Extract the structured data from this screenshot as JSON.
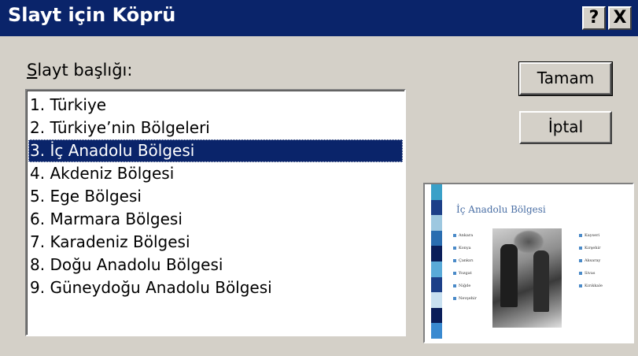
{
  "window": {
    "title": "Slayt için Köprü",
    "help_label": "?",
    "close_label": "X"
  },
  "list": {
    "label_accel": "S",
    "label_rest": "layt başlığı:",
    "selected_index": 2,
    "items": [
      {
        "label": "1. Türkiye"
      },
      {
        "label": "2. Türkiye’nin Bölgeleri"
      },
      {
        "label": "3. İç Anadolu Bölgesi"
      },
      {
        "label": "4. Akdeniz Bölgesi"
      },
      {
        "label": "5. Ege Bölgesi"
      },
      {
        "label": "6. Marmara Bölgesi"
      },
      {
        "label": "7. Karadeniz Bölgesi"
      },
      {
        "label": "8. Doğu Anadolu Bölgesi"
      },
      {
        "label": "9. Güneydoğu Anadolu Bölgesi"
      }
    ]
  },
  "buttons": {
    "ok_label": "Tamam",
    "cancel_label": "İptal"
  },
  "preview": {
    "slide_title": "İç Anadolu Bölgesi",
    "bullets_left": [
      "Ankara",
      "Konya",
      "Çankırı",
      "Yozgat",
      "Niğde",
      "Nevşehir"
    ],
    "bullets_right": [
      "Kayseri",
      "Kırşehir",
      "Aksaray",
      "Sivas",
      "Kırıkkale"
    ],
    "stripe_colors": [
      "#3aa0c8",
      "#1c3f88",
      "#9ec8e0",
      "#2a6db0",
      "#0a1e5a",
      "#5aaad8",
      "#1c3f88",
      "#c8e0f0",
      "#0a1e5a",
      "#3a8ad0"
    ]
  },
  "colors": {
    "titlebar": "#0a246a",
    "selection": "#0a246a",
    "face": "#d4d0c8"
  }
}
